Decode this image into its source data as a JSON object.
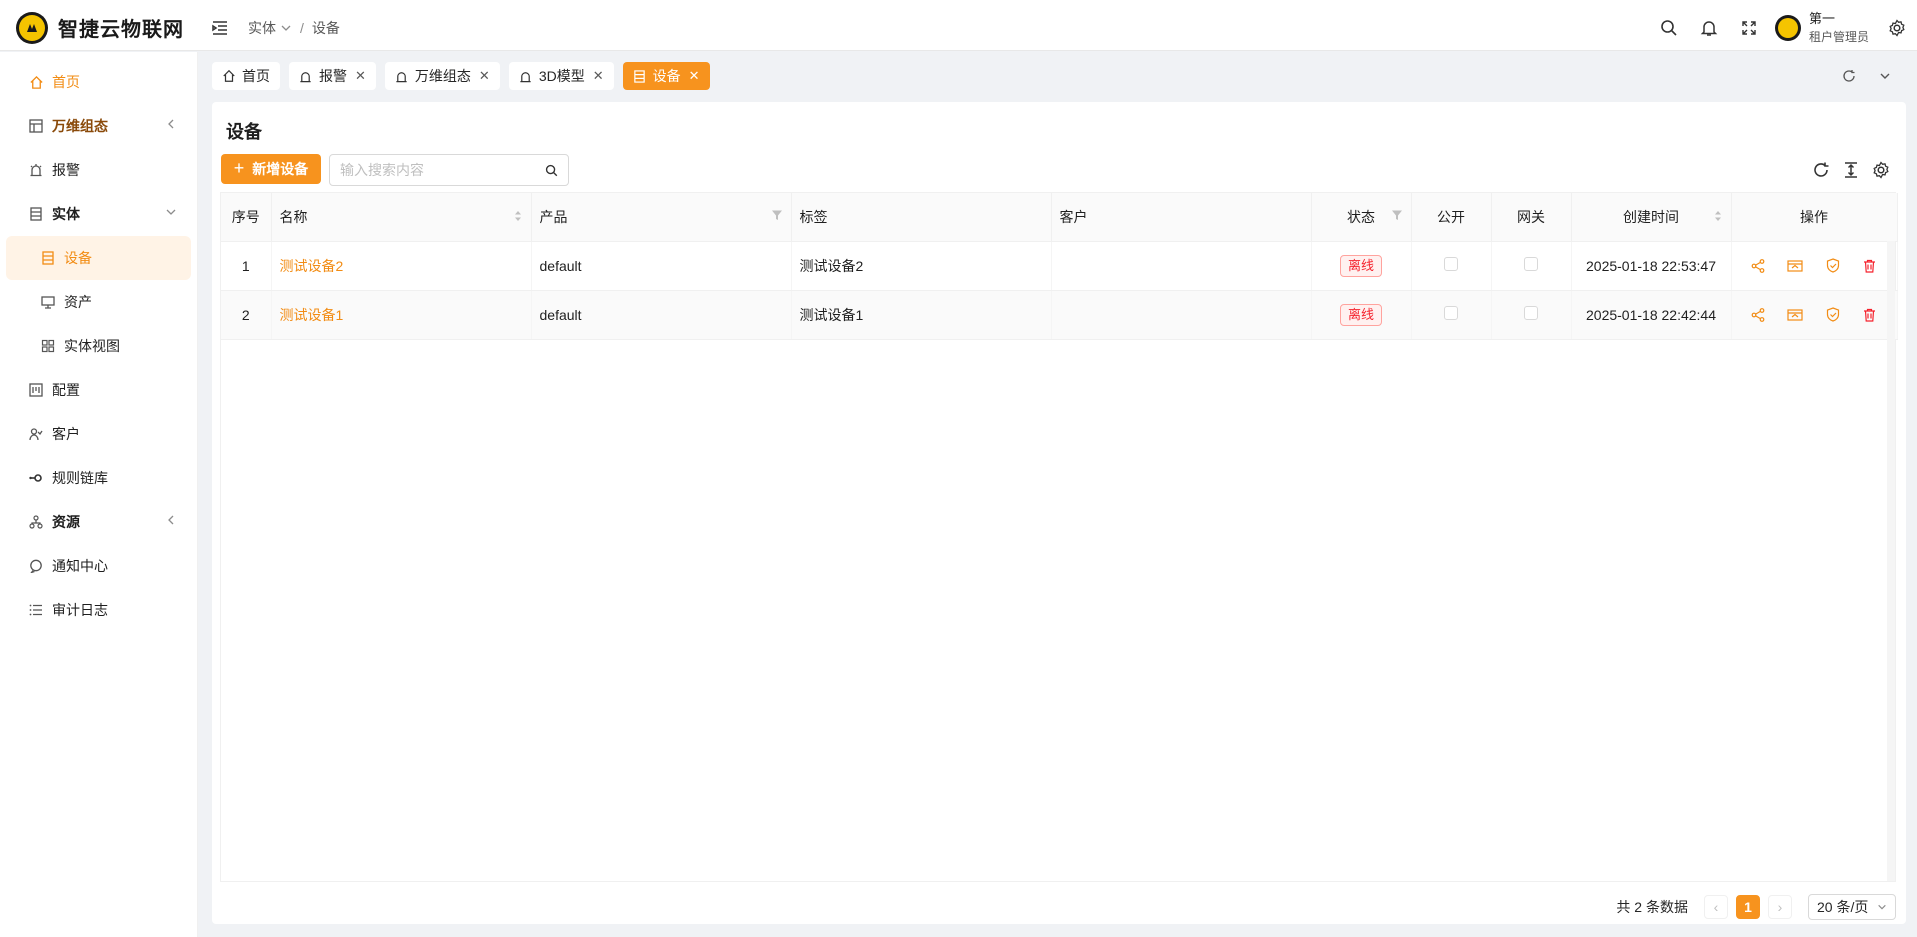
{
  "app": {
    "title": "智捷云物联网"
  },
  "breadcrumb": {
    "parent": "实体",
    "separator": "/",
    "current": "设备"
  },
  "user": {
    "name": "第一",
    "role": "租户管理员"
  },
  "sidebar": {
    "items": [
      {
        "label": "首页",
        "icon": "home-icon"
      },
      {
        "label": "万维组态",
        "icon": "layout-icon"
      },
      {
        "label": "报警",
        "icon": "alarm-icon"
      },
      {
        "label": "实体",
        "icon": "entity-icon"
      },
      {
        "label": "设备",
        "icon": "device-icon"
      },
      {
        "label": "资产",
        "icon": "monitor-icon"
      },
      {
        "label": "实体视图",
        "icon": "grid-icon"
      },
      {
        "label": "配置",
        "icon": "config-icon"
      },
      {
        "label": "客户",
        "icon": "customer-icon"
      },
      {
        "label": "规则链库",
        "icon": "rule-chain-icon"
      },
      {
        "label": "资源",
        "icon": "resource-icon"
      },
      {
        "label": "通知中心",
        "icon": "notification-icon"
      },
      {
        "label": "审计日志",
        "icon": "list-icon"
      }
    ]
  },
  "tabs": [
    {
      "label": "首页"
    },
    {
      "label": "报警"
    },
    {
      "label": "万维组态"
    },
    {
      "label": "3D模型"
    },
    {
      "label": "设备"
    }
  ],
  "page": {
    "title": "设备",
    "add_button": "新增设备",
    "search_placeholder": "输入搜索内容"
  },
  "table": {
    "columns": [
      "序号",
      "名称",
      "产品",
      "标签",
      "客户",
      "状态",
      "公开",
      "网关",
      "创建时间",
      "操作"
    ],
    "rows": [
      {
        "index": "1",
        "name": "测试设备2",
        "product": "default",
        "label": "测试设备2",
        "customer": "",
        "status": "离线",
        "created": "2025-01-18 22:53:47"
      },
      {
        "index": "2",
        "name": "测试设备1",
        "product": "default",
        "label": "测试设备1",
        "customer": "",
        "status": "离线",
        "created": "2025-01-18 22:42:44"
      }
    ]
  },
  "pagination": {
    "total_text": "共 2 条数据",
    "current": "1",
    "page_size": "20 条/页"
  },
  "colors": {
    "accent": "#f7931e",
    "danger": "#f5222d"
  }
}
